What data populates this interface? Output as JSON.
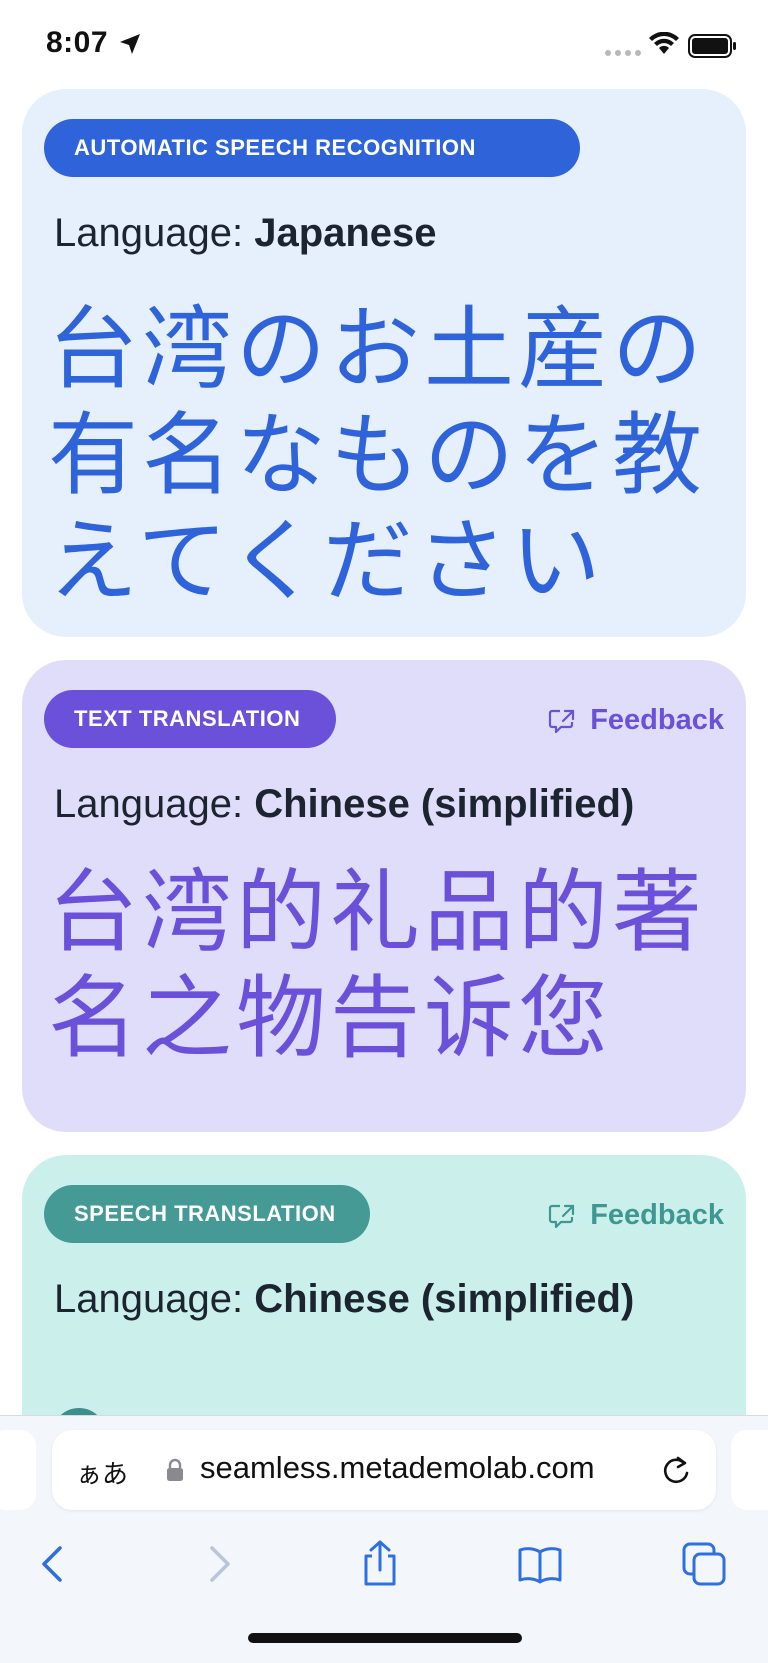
{
  "status": {
    "time": "8:07"
  },
  "cards": {
    "asr": {
      "badge": "AUTOMATIC SPEECH RECOGNITION",
      "language_prefix": "Language: ",
      "language": "Japanese",
      "text_lines": [
        "台湾のお土産の",
        "有名なものを教",
        "えてください"
      ]
    },
    "text_translation": {
      "badge": "TEXT TRANSLATION",
      "feedback": "Feedback",
      "language_prefix": "Language: ",
      "language": "Chinese (simplified)",
      "text_lines": [
        "台湾的礼品的著",
        "名之物告诉您"
      ]
    },
    "speech_translation": {
      "badge": "SPEECH TRANSLATION",
      "feedback": "Feedback",
      "language_prefix": "Language: ",
      "language": "Chinese (simplified)"
    }
  },
  "browser": {
    "text_size_label": "ぁあ",
    "url": "seamless.metademolab.com"
  },
  "colors": {
    "asr_accent": "#2e63d9",
    "tt_accent": "#6b51d9",
    "st_accent": "#459a96"
  }
}
